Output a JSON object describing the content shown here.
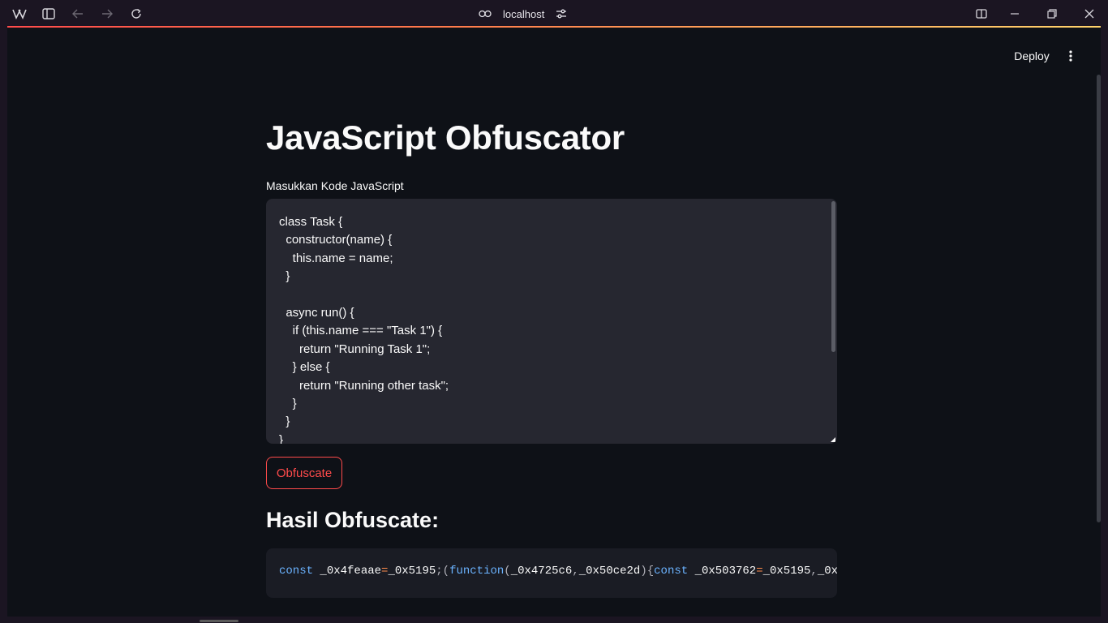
{
  "browser": {
    "url": "localhost"
  },
  "header": {
    "deploy_label": "Deploy"
  },
  "main": {
    "title": "JavaScript Obfuscator",
    "input_label": "Masukkan Kode JavaScript",
    "input_value": "class Task {\n  constructor(name) {\n    this.name = name;\n  }\n\n  async run() {\n    if (this.name === \"Task 1\") {\n      return \"Running Task 1\";\n    } else {\n      return \"Running other task\";\n    }\n  }\n}",
    "button_label": "Obfuscate",
    "result_heading": "Hasil Obfuscate:",
    "output_tokens": {
      "t1": "const",
      "t2": " _0x4feaae",
      "t3": "=",
      "t4": "_0x5195",
      "t5": ";(",
      "t6": "function",
      "t7": "(",
      "t8": "_0x4725c6",
      "t9": ",",
      "t10": "_0x50ce2d",
      "t11": "){",
      "t12": "const",
      "t13": " _0x503762",
      "t14": "=",
      "t15": "_0x5195",
      "t16": ",",
      "t17": "_0x"
    }
  },
  "colors": {
    "accent": "#ff4b4b",
    "background": "#0e1117",
    "code_background": "#262730"
  }
}
